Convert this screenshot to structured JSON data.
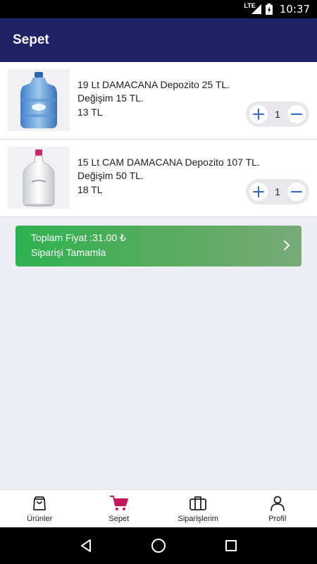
{
  "status_bar": {
    "network": "LTE",
    "time": "10:37"
  },
  "header": {
    "title": "Sepet"
  },
  "cart": {
    "items": [
      {
        "name": "19 Lt DAMACANA Depozito 25 TL. Değişim 15 TL.",
        "price": "13 TL",
        "quantity": "1",
        "image_icon": "water-jug-19l-image"
      },
      {
        "name": "15 Lt CAM DAMACANA Depozito 107 TL. Değişim 50 TL.",
        "price": "18 TL",
        "quantity": "1",
        "image_icon": "glass-bottle-15l-image"
      }
    ]
  },
  "checkout": {
    "total_label": "Toplam Fiyat :31.00 ₺",
    "action_label": "Siparişi Tamamla"
  },
  "bottom_nav": {
    "items": [
      {
        "label": "Ürünler",
        "icon": "bag-icon"
      },
      {
        "label": "Sepet",
        "icon": "cart-icon",
        "active": true
      },
      {
        "label": "Siparişlerim",
        "icon": "briefcase-icon"
      },
      {
        "label": "Profil",
        "icon": "person-icon"
      }
    ]
  },
  "colors": {
    "app_bar": "#1e2366",
    "active_tab": "#c2185b",
    "checkout_start": "#2eb250",
    "checkout_end": "#77ab79",
    "qty_icon": "#2b6cc4"
  }
}
